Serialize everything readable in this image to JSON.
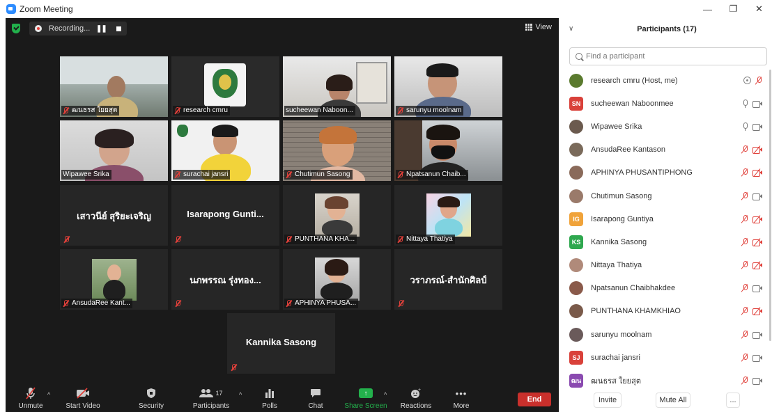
{
  "window": {
    "title": "Zoom Meeting",
    "controls": [
      "—",
      "❐",
      "✕"
    ]
  },
  "topbar": {
    "recording_label": "Recording...",
    "pause": "❚❚",
    "view_label": "View"
  },
  "tiles": [
    {
      "name": "ฒนธรส ใยยสุต",
      "video": true
    },
    {
      "name": "research cmru",
      "video": true
    },
    {
      "name": "sucheewan Naboon...",
      "video": true
    },
    {
      "name": "sarunyu moolnam",
      "video": true
    },
    {
      "name": "Wipawee Srika",
      "video": true
    },
    {
      "name": "surachai jansri",
      "video": true
    },
    {
      "name": "Chutimun Sasong",
      "video": true
    },
    {
      "name": "Npatsanun Chaib...",
      "video": true
    },
    {
      "name": "เสาวนีย์ สุริยะเจริญ",
      "video": false
    },
    {
      "name": "Isarapong  Gunti...",
      "video": false
    },
    {
      "name": "PUNTHANA KHA...",
      "video": true
    },
    {
      "name": "Nittaya Thatiya",
      "video": true
    },
    {
      "name": "AnsudaRee Kant...",
      "video": true
    },
    {
      "name": "นภพรรณ รุ่งทอง...",
      "video": false
    },
    {
      "name": "APHINYA PHUSA...",
      "video": true
    },
    {
      "name": "วราภรณ์-สำนักศิลป์",
      "video": false
    },
    {
      "name": "Kannika Sasong",
      "video": false
    }
  ],
  "toolbar": {
    "unmute": "Unmute",
    "start_video": "Start Video",
    "security": "Security",
    "participants": "Participants",
    "participants_count": "17",
    "polls": "Polls",
    "chat": "Chat",
    "share_screen": "Share Screen",
    "reactions": "Reactions",
    "more": "More",
    "end": "End"
  },
  "panel": {
    "title": "Participants (17)",
    "search_placeholder": "Find a participant",
    "participants": [
      {
        "name": "research cmru (Host, me)",
        "avatar": "",
        "color": "#5a7a2e",
        "mic": "off",
        "cam": "rec"
      },
      {
        "name": "sucheewan Naboonmee",
        "avatar": "SN",
        "color": "#d9413a",
        "mic": "on",
        "cam": "on"
      },
      {
        "name": "Wipawee Srika",
        "avatar": "",
        "color": "#6b5a4e",
        "mic": "on",
        "cam": "on"
      },
      {
        "name": "AnsudaRee Kantason",
        "avatar": "",
        "color": "#7a6a5a",
        "mic": "off",
        "cam": "off"
      },
      {
        "name": "APHINYA PHUSANTIPHONG",
        "avatar": "",
        "color": "#8a6a5a",
        "mic": "off",
        "cam": "off"
      },
      {
        "name": "Chutimun Sasong",
        "avatar": "",
        "color": "#9a7a6a",
        "mic": "off",
        "cam": "on"
      },
      {
        "name": "Isarapong Guntiya",
        "avatar": "IG",
        "color": "#f0a33a",
        "mic": "off",
        "cam": "off"
      },
      {
        "name": "Kannika Sasong",
        "avatar": "KS",
        "color": "#2fa84f",
        "mic": "off",
        "cam": "off"
      },
      {
        "name": "Nittaya Thatiya",
        "avatar": "",
        "color": "#b08a7a",
        "mic": "off",
        "cam": "off"
      },
      {
        "name": "Npatsanun Chaibhakdee",
        "avatar": "",
        "color": "#8a5a4a",
        "mic": "off",
        "cam": "on"
      },
      {
        "name": "PUNTHANA KHAMKHIAO",
        "avatar": "",
        "color": "#7a5a4a",
        "mic": "off",
        "cam": "off"
      },
      {
        "name": "sarunyu moolnam",
        "avatar": "",
        "color": "#6a5a5a",
        "mic": "off",
        "cam": "on"
      },
      {
        "name": "surachai jansri",
        "avatar": "SJ",
        "color": "#d9413a",
        "mic": "off",
        "cam": "on"
      },
      {
        "name": "ฒนธรส ใยยสุต",
        "avatar": "ฒน",
        "color": "#8a4ab0",
        "mic": "off",
        "cam": "on"
      }
    ],
    "invite": "Invite",
    "mute_all": "Mute All",
    "more": "..."
  }
}
